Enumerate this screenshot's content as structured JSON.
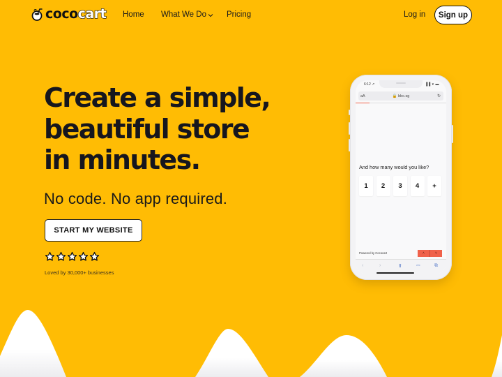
{
  "nav": {
    "logo_text_left": "coco",
    "logo_text_right": "cart",
    "logo_icon": "coconut-icon",
    "links": [
      {
        "label": "Home"
      },
      {
        "label": "What We Do",
        "icon": "chevron-down-icon"
      },
      {
        "label": "Pricing"
      }
    ],
    "login_label": "Log in",
    "signup_label": "Sign up"
  },
  "hero": {
    "headline_lines": [
      "Create a simple,",
      "beautiful store",
      "in minutes."
    ],
    "subheadline": "No code. No app required.",
    "cta_label": "START MY WEBSITE",
    "rating": {
      "stars": 5,
      "max": 5
    },
    "social_proof": "Loved by 30,000+ businesses"
  },
  "phone": {
    "status_time": "6:12 ↗",
    "status_icons": "▐▐ ▾ ▬",
    "url_aa": "aA",
    "url": "🔒 bbc.sg",
    "reload_icon": "↻",
    "progress": 0.15,
    "question": "And how many would you like?",
    "quantity_options": [
      "1",
      "2",
      "3",
      "4",
      "+"
    ],
    "powered_by": "Powered by Cococart",
    "prev_label": "˄",
    "next_label": "˅",
    "toolbar": {
      "back": "‹",
      "forward": "›",
      "share": "⬆",
      "bookmarks": "⎓",
      "tabs": "⧉"
    }
  },
  "colors": {
    "background": "#FFBC04",
    "text": "#16161E",
    "accent": "#F0614A"
  }
}
